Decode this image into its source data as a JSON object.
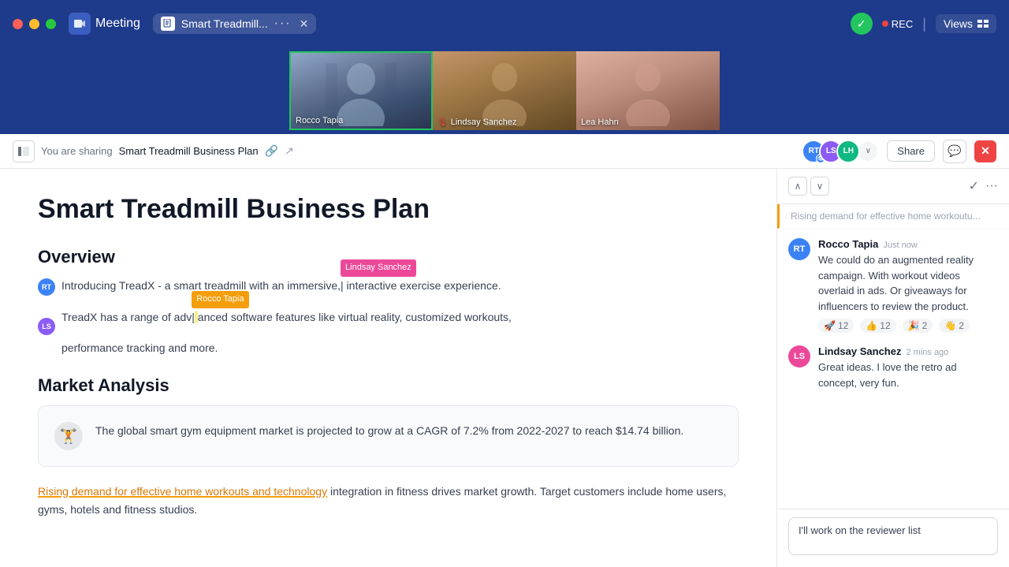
{
  "titlebar": {
    "meeting_label": "Meeting",
    "tab_label": "Smart Treadmill...",
    "tab_more": "···",
    "rec_label": "REC",
    "views_label": "Views"
  },
  "video_strip": {
    "participants": [
      {
        "name": "Rocco Tapia",
        "active": true,
        "mic_off": false
      },
      {
        "name": "Lindsay Sanchez",
        "active": false,
        "mic_off": true
      },
      {
        "name": "Lea Hahn",
        "active": false,
        "mic_off": false
      }
    ]
  },
  "sharing_bar": {
    "you_are_sharing": "You are sharing",
    "doc_name": "Smart Treadmill Business Plan",
    "share_label": "Share"
  },
  "document": {
    "title": "Smart Treadmill Business Plan",
    "overview_heading": "Overview",
    "overview_text_1": "Introducing TreadX - a smart treadmill with an immersive,",
    "cursor_lindsay": "Lindsay Sanchez",
    "overview_text_2": " interactive exercise experience.",
    "overview_text_3": "TreadX has a range of adv",
    "cursor_rocco": "Rocco Tapia",
    "overview_text_4": "anced software features like virtual reality, customized workouts,",
    "overview_text_5": "performance tracking and more.",
    "market_heading": "Market Analysis",
    "market_stat": "The global smart gym equipment market is projected to grow at a CAGR of 7.2% from 2022-2027 to reach $14.74 billion.",
    "rising_text": "Rising demand for effective home workouts and technology",
    "rising_rest": " integration in fitness drives market growth. Target customers include home users, gyms, hotels and fitness studios."
  },
  "comment_panel": {
    "thread_label": "Rising demand for effective home workoutu...",
    "nav_prev": "∧",
    "nav_next": "∨",
    "comments": [
      {
        "author": "Rocco Tapia",
        "time": "Just now",
        "text": "We could do an augmented reality campaign. With workout videos overlaid in ads. Or giveaways for influencers to review the product.",
        "reactions": [
          {
            "emoji": "🚀",
            "count": "12"
          },
          {
            "emoji": "👍",
            "count": "12"
          },
          {
            "emoji": "🎉",
            "count": "2"
          },
          {
            "emoji": "👋",
            "count": "2"
          }
        ]
      },
      {
        "author": "Lindsay Sanchez",
        "time": "2 mins ago",
        "text": "Great ideas. I love the retro ad concept, very fun.",
        "reactions": []
      }
    ],
    "input_value": "I'll work on the reviewer list"
  },
  "colors": {
    "accent_blue": "#1e3a8a",
    "green": "#22c55e",
    "red": "#ef4444",
    "yellow": "#f59e0b",
    "pink": "#ec4899"
  }
}
